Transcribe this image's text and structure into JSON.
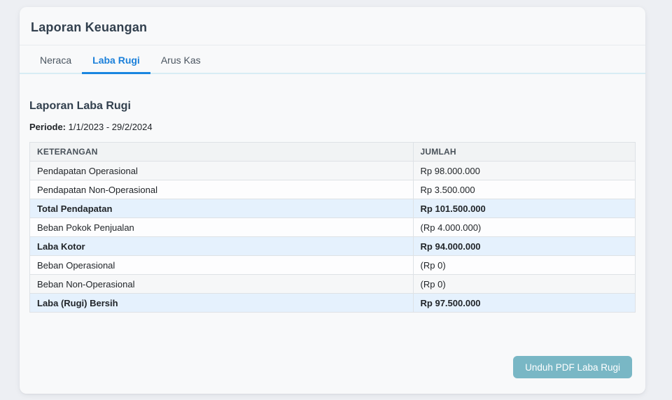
{
  "page": {
    "title": "Laporan Keuangan"
  },
  "tabs": [
    {
      "label": "Neraca",
      "active": false
    },
    {
      "label": "Laba Rugi",
      "active": true
    },
    {
      "label": "Arus Kas",
      "active": false
    }
  ],
  "report": {
    "title": "Laporan Laba Rugi",
    "period_label": "Periode:",
    "period_value": " 1/1/2023 - 29/2/2024"
  },
  "table": {
    "headers": [
      "KETERANGAN",
      "JUMLAH"
    ],
    "rows": [
      {
        "label": "Pendapatan Operasional",
        "value": "Rp 98.000.000",
        "emphasis": false
      },
      {
        "label": "Pendapatan Non-Operasional",
        "value": "Rp 3.500.000",
        "emphasis": false
      },
      {
        "label": "Total Pendapatan",
        "value": "Rp 101.500.000",
        "emphasis": true
      },
      {
        "label": "Beban Pokok Penjualan",
        "value": "(Rp 4.000.000)",
        "emphasis": false
      },
      {
        "label": "Laba Kotor",
        "value": "Rp 94.000.000",
        "emphasis": true
      },
      {
        "label": "Beban Operasional",
        "value": "(Rp 0)",
        "emphasis": false
      },
      {
        "label": "Beban Non-Operasional",
        "value": "(Rp 0)",
        "emphasis": false
      },
      {
        "label": "Laba (Rugi) Bersih",
        "value": "Rp 97.500.000",
        "emphasis": true
      }
    ]
  },
  "actions": {
    "download_pdf_label": "Unduh PDF Laba Rugi"
  },
  "colors": {
    "accent_blue": "#1b80da",
    "tab_underline": "#1a86e0",
    "button_teal": "#79b7c5",
    "total_row_bg": "#e5f1fd",
    "card_bg": "#f8f9fa",
    "page_bg": "#edeff3"
  }
}
